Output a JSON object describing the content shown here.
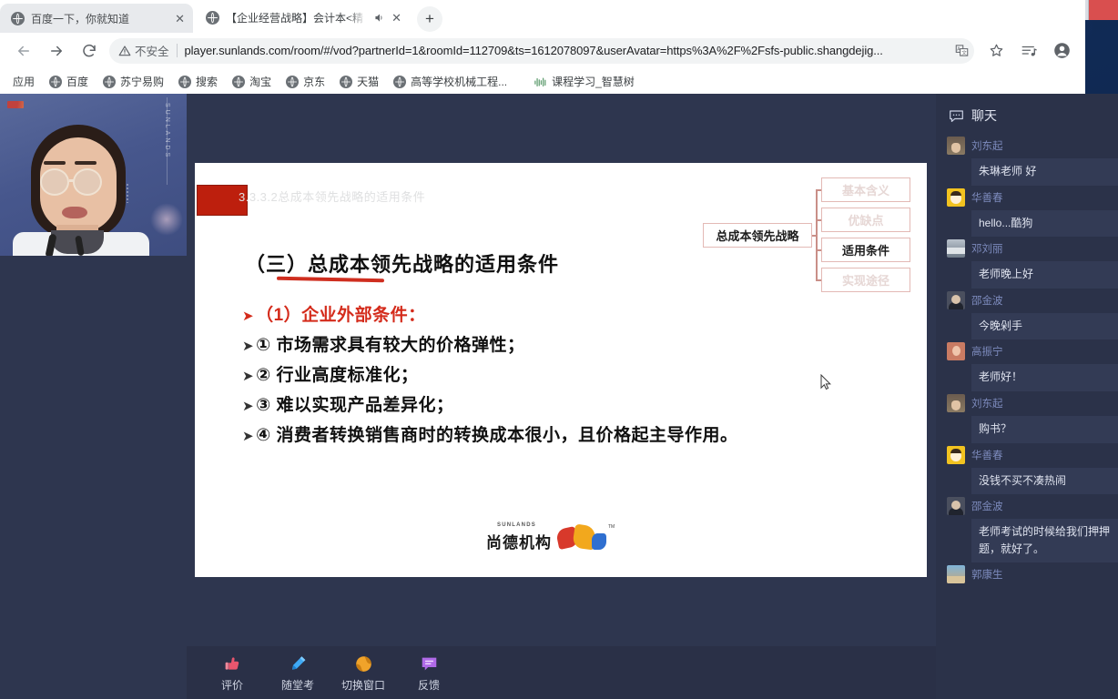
{
  "window": {
    "controls": {
      "minimize": "minimize",
      "restore": "restore",
      "close": "close"
    },
    "gadget_name": "desktop-cpu-meter"
  },
  "browser": {
    "tabs": [
      {
        "title": "百度一下，你就知道",
        "favicon": "globe-icon",
        "active": false,
        "audio": false
      },
      {
        "title": "【企业经营战略】会计本<精",
        "favicon": "globe-icon",
        "active": true,
        "audio": true
      }
    ],
    "new_tab_label": "+",
    "nav": {
      "back": "back-icon",
      "forward": "→",
      "reload": "C"
    },
    "omnibox": {
      "security_label": "不安全",
      "warning_icon": "warning-triangle-icon",
      "url": "player.sunlands.com/room/#/vod?partnerId=1&roomId=112709&ts=1612078097&userAvatar=https%3A%2F%2Fsfs-public.shangdejig...",
      "translate_icon": "translate-icon"
    },
    "toolbar_right": [
      "bookmark-star-icon",
      "reading-list-icon",
      "profile-avatar-icon"
    ],
    "bookmarks": [
      {
        "label": "应用",
        "icon": "apps-icon"
      },
      {
        "label": "百度",
        "icon": "globe-icon"
      },
      {
        "label": "苏宁易购",
        "icon": "globe-icon"
      },
      {
        "label": "搜索",
        "icon": "globe-icon"
      },
      {
        "label": "淘宝",
        "icon": "globe-icon"
      },
      {
        "label": "京东",
        "icon": "globe-icon"
      },
      {
        "label": "天猫",
        "icon": "globe-icon"
      },
      {
        "label": "高等学校机械工程...",
        "icon": "globe-icon"
      },
      {
        "label": "课程学习_智慧树",
        "icon": "wave-icon"
      }
    ]
  },
  "player": {
    "camera": {
      "brand": "SUNLANDS"
    },
    "slide": {
      "ghost_title": "3.3.3.2总成本领先战略的适用条件",
      "heading": "（三）总成本领先战略的适用条件",
      "bullets": [
        {
          "arrow": "➤",
          "text": "（1）企业外部条件：",
          "color": "red"
        },
        {
          "arrow": "➤",
          "text": "① 市场需求具有较大的价格弹性；",
          "color": "dark"
        },
        {
          "arrow": "➤",
          "text": "② 行业高度标准化；",
          "color": "dark"
        },
        {
          "arrow": "➤",
          "text": "③ 难以实现产品差异化；",
          "color": "dark"
        },
        {
          "arrow": "➤",
          "text": "④ 消费者转换销售商时的转换成本很小，且价格起主导作用。",
          "color": "dark"
        }
      ],
      "flowchart": {
        "root": "总成本领先战略",
        "leaves": [
          {
            "label": "基本含义",
            "active": false
          },
          {
            "label": "优缺点",
            "active": false
          },
          {
            "label": "适用条件",
            "active": true
          },
          {
            "label": "实现途径",
            "active": false
          }
        ]
      },
      "logo": {
        "en": "SUNLANDS",
        "cn": "尚德机构",
        "tm": "TM"
      }
    },
    "toolbar": [
      {
        "label": "评价",
        "icon": "thumbs-up-icon",
        "color": "#e8566e"
      },
      {
        "label": "随堂考",
        "icon": "pen-icon",
        "color": "#3fa9f5"
      },
      {
        "label": "切换窗口",
        "icon": "swap-window-icon",
        "color": "#f0a32a"
      },
      {
        "label": "反馈",
        "icon": "feedback-bubble-icon",
        "color": "#b06ae8"
      }
    ]
  },
  "chat": {
    "title": "聊天",
    "title_icon": "chat-bubble-icon",
    "messages": [
      {
        "name": "刘东起",
        "text": "朱琳老师 好",
        "avatar": "a1"
      },
      {
        "name": "华善春",
        "text": "hello...酷狗",
        "avatar": "a2"
      },
      {
        "name": "邓刘丽",
        "text": "老师晚上好",
        "avatar": "a3"
      },
      {
        "name": "邵金波",
        "text": "今晚剁手",
        "avatar": "a4"
      },
      {
        "name": "高振宁",
        "text": "老师好！",
        "avatar": "a5"
      },
      {
        "name": "刘东起",
        "text": "购书？",
        "avatar": "a1"
      },
      {
        "name": "华善春",
        "text": "没钱不买不凑热闹",
        "avatar": "a2"
      },
      {
        "name": "邵金波",
        "text": "老师考试的时候给我们押押题，就好了。",
        "avatar": "a4"
      },
      {
        "name": "郭康生",
        "text": "",
        "avatar": "a6"
      }
    ]
  },
  "colors": {
    "chat_bg": "#2b3249",
    "bubble_bg": "#333b55",
    "name": "#7d8bbd",
    "stage_bg": "#2e364f",
    "toolbar_bg": "#2a3047",
    "accent_red": "#d42b1b"
  }
}
